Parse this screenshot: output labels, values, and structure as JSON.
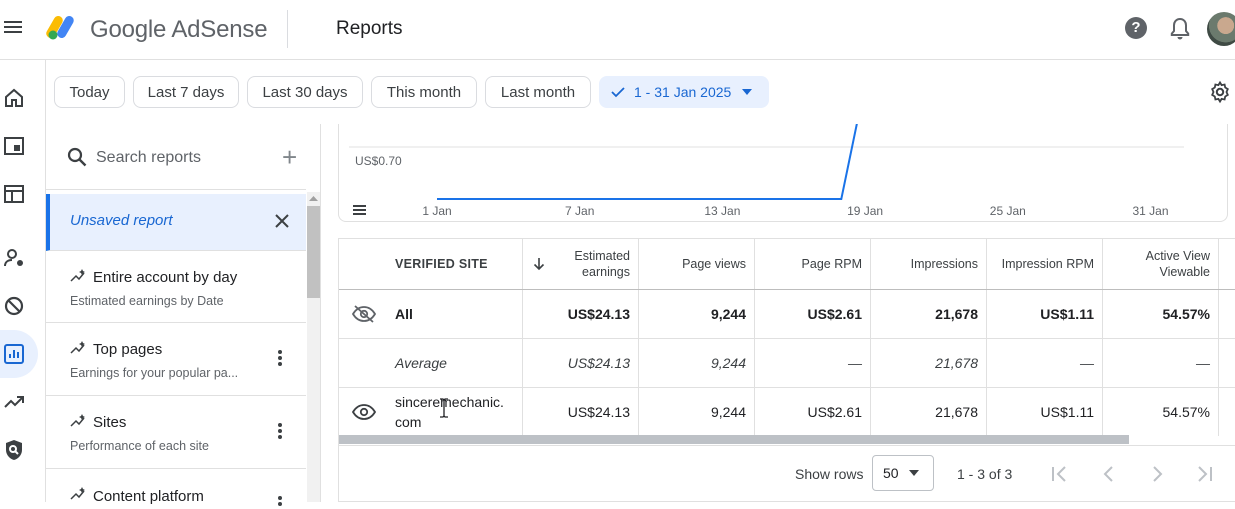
{
  "header": {
    "app_name": "Google AdSense",
    "page_title": "Reports",
    "help_label": "?"
  },
  "date_filters": {
    "chips": [
      "Today",
      "Last 7 days",
      "Last 30 days",
      "This month",
      "Last month"
    ],
    "selected": "1 - 31 Jan 2025"
  },
  "sidebar": {
    "search_placeholder": "Search reports",
    "add_label": "+",
    "reports": [
      {
        "name": "Unsaved report",
        "desc": ""
      },
      {
        "name": "Entire account by day",
        "desc": "Estimated earnings by Date"
      },
      {
        "name": "Top pages",
        "desc": "Earnings for your popular pa..."
      },
      {
        "name": "Sites",
        "desc": "Performance of each site"
      },
      {
        "name": "Content platform",
        "desc": ""
      }
    ]
  },
  "chart_data": {
    "type": "line",
    "x": [
      "1 Jan",
      "7 Jan",
      "13 Jan",
      "19 Jan",
      "25 Jan",
      "31 Jan"
    ],
    "y_tick_label": "US$0.70",
    "series": [
      {
        "values": [
          0,
          0,
          0,
          0,
          0,
          0,
          0,
          0,
          0,
          0,
          0,
          0,
          0,
          0,
          0,
          0,
          0,
          0,
          0.7
        ]
      }
    ]
  },
  "table": {
    "columns": [
      "VERIFIED SITE",
      "Estimated earnings",
      "Page views",
      "Page RPM",
      "Impressions",
      "Impression RPM",
      "Active View Viewable"
    ],
    "rows": [
      {
        "site": "All",
        "earnings": "US$24.13",
        "page_views": "9,244",
        "page_rpm": "US$2.61",
        "impressions": "21,678",
        "impression_rpm": "US$1.11",
        "viewable": "54.57%"
      },
      {
        "site": "Average",
        "earnings": "US$24.13",
        "page_views": "9,244",
        "page_rpm": "—",
        "impressions": "21,678",
        "impression_rpm": "—",
        "viewable": "—"
      },
      {
        "site": "sinceremechanic.com",
        "site_line1": "sinceremechanic.",
        "site_line2": "com",
        "earnings": "US$24.13",
        "page_views": "9,244",
        "page_rpm": "US$2.61",
        "impressions": "21,678",
        "impression_rpm": "US$1.11",
        "viewable": "54.57%"
      }
    ]
  },
  "pagination": {
    "show_rows_label": "Show rows",
    "rows_value": "50",
    "range": "1 - 3 of 3"
  },
  "colors": {
    "accent": "#1a73e8",
    "chip_selected_bg": "#e8f0fe",
    "chart_line": "#1a73e8"
  }
}
